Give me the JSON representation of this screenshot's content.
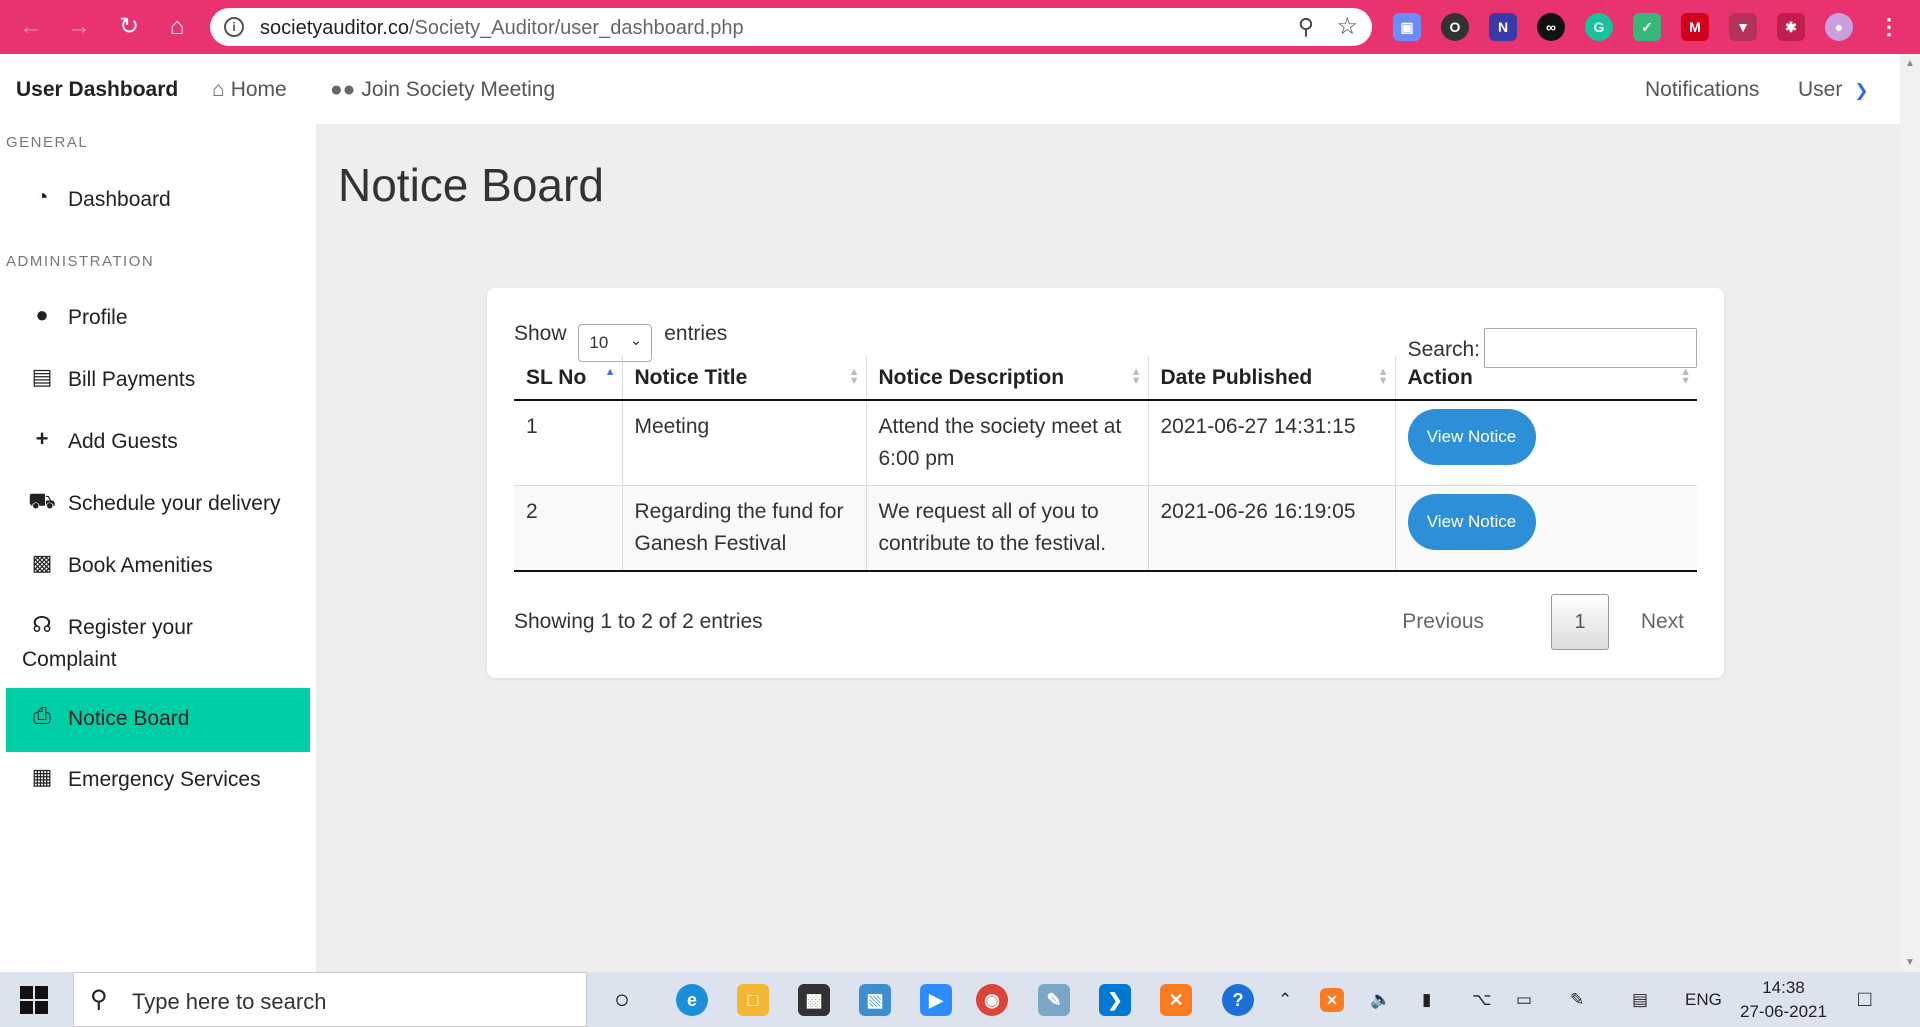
{
  "browser": {
    "url_host": "societyauditor.co",
    "url_path": "/Society_Auditor/user_dashboard.php",
    "theme_color": "#e8336e"
  },
  "navbar": {
    "brand": "User Dashboard",
    "home": "Home",
    "join_meeting": "Join Society Meeting",
    "notifications": "Notifications",
    "user": "User"
  },
  "sidebar": {
    "section_general": "GENERAL",
    "section_admin": "ADMINISTRATION",
    "items": [
      {
        "label": "Dashboard",
        "icon": "dashboard-icon"
      },
      {
        "label": "Profile",
        "icon": "users-icon"
      },
      {
        "label": "Bill Payments",
        "icon": "credit-card-icon"
      },
      {
        "label": "Add Guests",
        "icon": "plus-icon"
      },
      {
        "label": "Schedule your delivery",
        "icon": "truck-icon"
      },
      {
        "label": "Book Amenities",
        "icon": "store-icon"
      },
      {
        "label": "Register your Complaint",
        "icon": "headset-icon"
      },
      {
        "label": "Notice Board",
        "icon": "clipboard-icon",
        "active": true
      },
      {
        "label": "Emergency Services",
        "icon": "hospital-icon"
      }
    ],
    "active_color": "#00cea6"
  },
  "main": {
    "title": "Notice Board",
    "show_label": "Show",
    "entries_value": "10",
    "entries_label": "entries",
    "search_label": "Search:",
    "columns": [
      "SL No",
      "Notice Title",
      "Notice Description",
      "Date Published",
      "Action"
    ],
    "rows": [
      {
        "sl": "1",
        "title": "Meeting",
        "description": "Attend the society meet at 6:00 pm",
        "date": "2021-06-27 14:31:15",
        "action": "View Notice"
      },
      {
        "sl": "2",
        "title": "Regarding the fund for Ganesh Festival",
        "description": "We request all of you to contribute to the festival.",
        "date": "2021-06-26 16:19:05",
        "action": "View Notice"
      }
    ],
    "info": "Showing 1 to 2 of 2 entries",
    "pager": {
      "previous": "Previous",
      "page": "1",
      "next": "Next"
    },
    "button_color": "#2e8fd9"
  },
  "taskbar": {
    "search_placeholder": "Type here to search",
    "language": "ENG",
    "time": "14:38",
    "date": "27-06-2021"
  }
}
